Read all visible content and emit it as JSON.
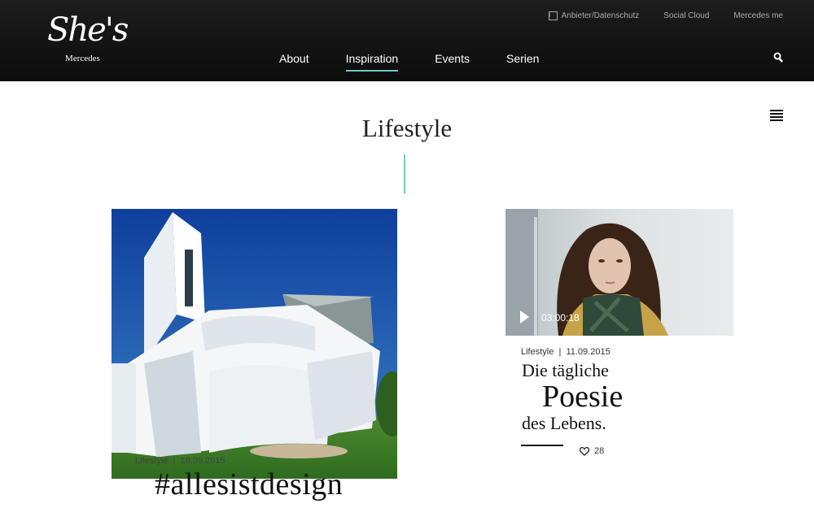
{
  "header": {
    "logo_script": "She's",
    "logo_sub": "Mercedes",
    "top_links": [
      "Anbieter/Datenschutz",
      "Social Cloud",
      "Mercedes me"
    ],
    "nav": [
      "About",
      "Inspiration",
      "Events",
      "Serien"
    ],
    "active_nav": "Inspiration",
    "accent_color": "#6ec9c4"
  },
  "page": {
    "title": "Lifestyle"
  },
  "cards": [
    {
      "category": "Lifestyle",
      "date": "18.09.2015",
      "title": "#allesistdesign"
    },
    {
      "category": "Lifestyle",
      "date": "11.09.2015",
      "duration": "03:00:18",
      "title_line1": "Die tägliche",
      "title_line2": "Poesie",
      "title_line3": "des Lebens.",
      "likes": "28"
    }
  ]
}
